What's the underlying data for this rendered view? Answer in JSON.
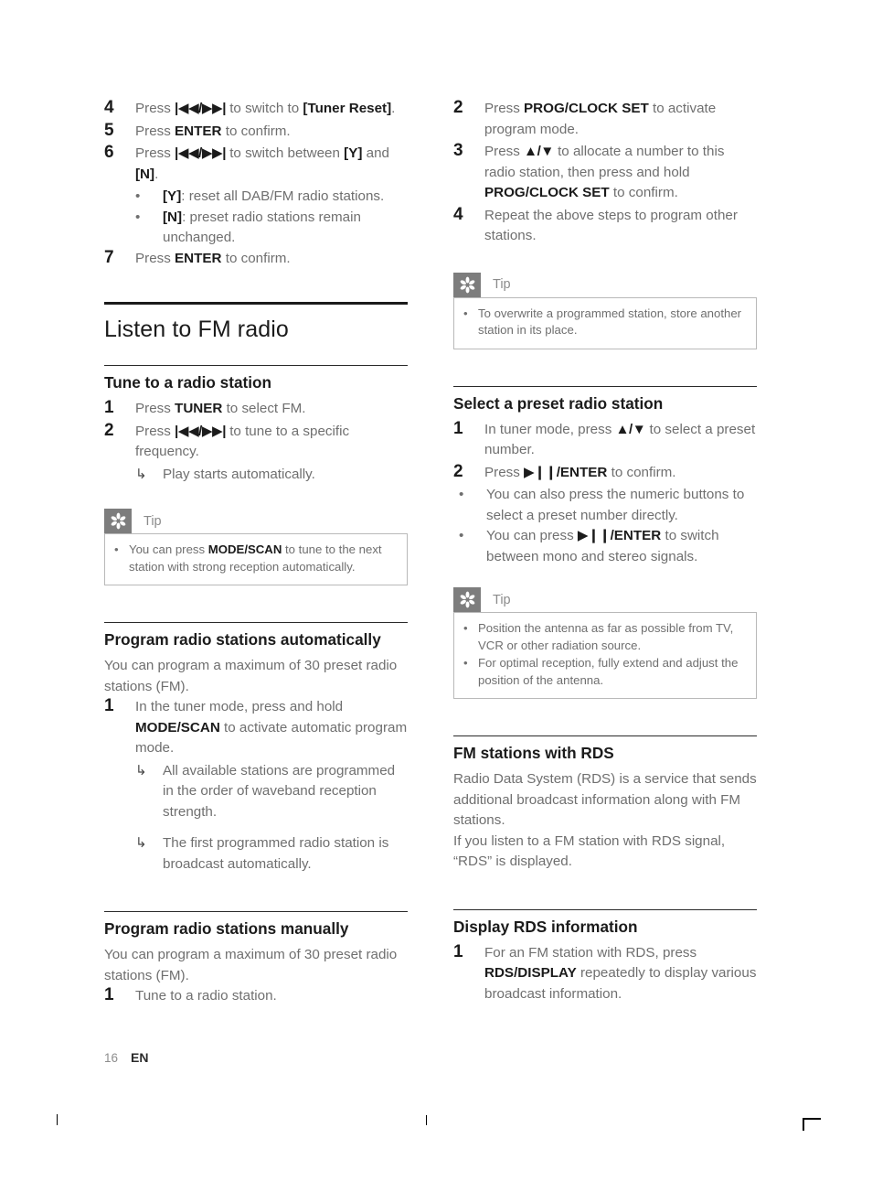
{
  "document": {
    "page_number": "16",
    "language_code": "EN"
  },
  "left_column": {
    "continued_steps": [
      {
        "num": "4",
        "text_before": "Press ",
        "glyph": "|◀◀/▶▶|",
        "text_after": " to switch to ",
        "bold": "[Tuner Reset]",
        "text_end": "."
      },
      {
        "num": "5",
        "text_before": "Press ",
        "bold": "ENTER",
        "text_after": " to confirm."
      },
      {
        "num": "6",
        "text_before": "Press ",
        "glyph": "|◀◀/▶▶|",
        "text_after": " to switch between ",
        "bold": "[Y]",
        "text_mid": " and ",
        "bold2": "[N]",
        "text_end": "."
      }
    ],
    "step6_bullets": [
      {
        "mark": "•",
        "bold": "[Y]",
        "text": ": reset all DAB/FM radio stations."
      },
      {
        "mark": "•",
        "bold": "[N]",
        "text": ": preset radio stations remain unchanged."
      }
    ],
    "step7": {
      "num": "7",
      "text_before": "Press ",
      "bold": "ENTER",
      "text_after": " to confirm."
    },
    "title": "Listen to FM radio",
    "section_tune": {
      "heading": "Tune to a radio station",
      "steps": [
        {
          "num": "1",
          "text_before": "Press ",
          "bold": "TUNER",
          "text_after": " to select FM."
        },
        {
          "num": "2",
          "text_before": "Press ",
          "glyph": "|◀◀/▶▶|",
          "text_after": " to tune to a specific frequency."
        }
      ],
      "result": {
        "mark": "↳",
        "text": "Play starts automatically."
      },
      "tip": {
        "label": "Tip",
        "icon": "asterisk-icon",
        "items": [
          {
            "mark": "•",
            "text_before": "You can press ",
            "bold": "MODE/SCAN",
            "text_after": " to tune to the next station with strong reception automatically."
          }
        ]
      }
    },
    "section_auto": {
      "heading": "Program radio stations automatically",
      "intro": "You can program a maximum of 30 preset radio stations (FM).",
      "steps": [
        {
          "num": "1",
          "text_before": "In the tuner mode, press and hold ",
          "bold": "MODE/SCAN",
          "text_after": " to activate automatic program mode."
        }
      ],
      "results": [
        {
          "mark": "↳",
          "text": "All available stations are programmed in the order of waveband reception strength."
        },
        {
          "mark": "↳",
          "text": "The first programmed radio station is broadcast automatically."
        }
      ]
    },
    "section_manual": {
      "heading": "Program radio stations manually",
      "intro": "You can program a maximum of 30 preset radio stations (FM).",
      "steps": [
        {
          "num": "1",
          "text": "Tune to a radio station."
        }
      ]
    }
  },
  "right_column": {
    "manual_steps_continued": [
      {
        "num": "2",
        "text_before": "Press ",
        "bold": "PROG/CLOCK SET",
        "text_after": " to activate program mode."
      },
      {
        "num": "3",
        "text_before": "Press ",
        "glyph": "▲/▼",
        "text_after": " to allocate a number to this radio station, then press and hold ",
        "bold": "PROG/CLOCK SET",
        "text_end": " to confirm."
      },
      {
        "num": "4",
        "text": "Repeat the above steps to program other stations."
      }
    ],
    "tip_overwrite": {
      "label": "Tip",
      "icon": "asterisk-icon",
      "items": [
        {
          "mark": "•",
          "text": "To overwrite a programmed station, store another station in its place."
        }
      ]
    },
    "section_preset": {
      "heading": "Select a preset radio station",
      "steps": [
        {
          "num": "1",
          "text_before": "In tuner mode, press ",
          "glyph": "▲/▼",
          "text_after": " to select a preset number."
        },
        {
          "num": "2",
          "text_before": "Press ",
          "glyph": "▶❙❙",
          "bold": "/ENTER",
          "text_after": " to confirm."
        }
      ],
      "bullets": [
        {
          "mark": "•",
          "text": "You can also press the numeric buttons to select a preset number directly."
        },
        {
          "mark": "•",
          "text_before": "You can press ",
          "glyph": "▶❙❙",
          "bold": "/ENTER",
          "text_after": " to switch between mono and stereo signals."
        }
      ],
      "tip": {
        "label": "Tip",
        "icon": "asterisk-icon",
        "items": [
          {
            "mark": "•",
            "text": "Position the antenna as far as possible from TV, VCR or other radiation source."
          },
          {
            "mark": "•",
            "text": "For optimal reception, fully extend and adjust the position of the antenna."
          }
        ]
      }
    },
    "section_rds": {
      "heading": "FM stations with RDS",
      "paragraph1": "Radio Data System (RDS) is a service that sends additional broadcast information along with FM stations.",
      "paragraph2": "If you listen to a FM station with RDS signal, “RDS” is displayed."
    },
    "section_rds_display": {
      "heading": "Display RDS information",
      "steps": [
        {
          "num": "1",
          "text_before": "For an FM station with RDS, press ",
          "bold": "RDS/DISPLAY",
          "text_after": " repeatedly to display various broadcast information."
        }
      ]
    }
  },
  "colors": {
    "body_text": "#6f6f6f",
    "bold_text": "#1b1b1b",
    "tip_icon_bg": "#7d7d7d",
    "tip_border": "#b9b9b9",
    "rule": "#1b1b1b"
  }
}
